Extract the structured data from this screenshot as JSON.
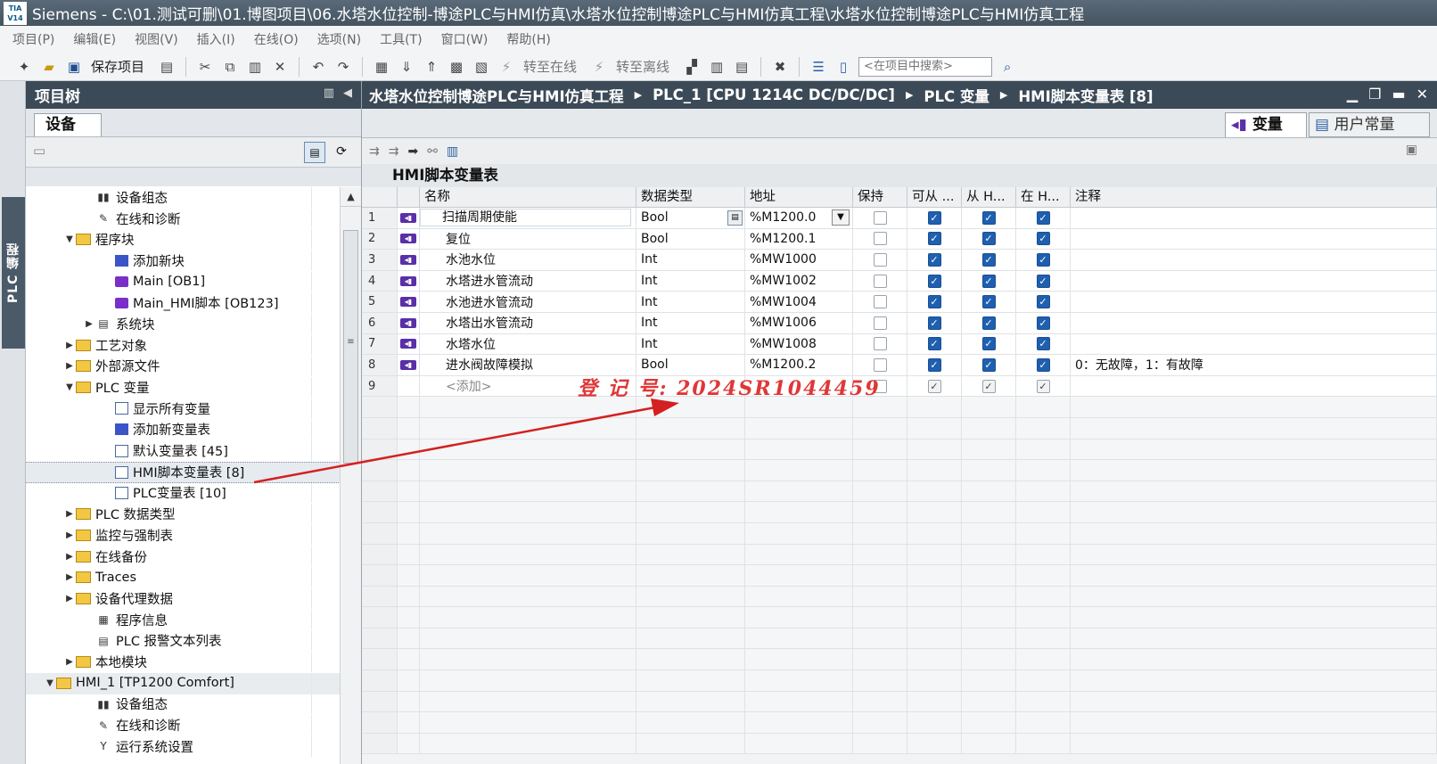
{
  "titlebar": {
    "logo": "TIA V14",
    "title": "Siemens  -  C:\\01.测试可删\\01.博图项目\\06.水塔水位控制-博途PLC与HMI仿真\\水塔水位控制博途PLC与HMI仿真工程\\水塔水位控制博途PLC与HMI仿真工程"
  },
  "menu": [
    "项目(P)",
    "编辑(E)",
    "视图(V)",
    "插入(I)",
    "在线(O)",
    "选项(N)",
    "工具(T)",
    "窗口(W)",
    "帮助(H)"
  ],
  "toolbar": {
    "save_label": "保存项目",
    "go_online": "转至在线",
    "go_offline": "转至离线",
    "search_placeholder": "<在项目中搜索>"
  },
  "left_vtab": "PLC 编程",
  "tree": {
    "header": "项目树",
    "tab": "设备",
    "items": [
      {
        "indent": 3,
        "arrow": "",
        "icon": "gen",
        "glyph": "▮▮",
        "label": "设备组态"
      },
      {
        "indent": 3,
        "arrow": "",
        "icon": "gen",
        "glyph": "✎",
        "label": "在线和诊断"
      },
      {
        "indent": 2,
        "arrow": "▼",
        "icon": "folder",
        "glyph": "",
        "label": "程序块"
      },
      {
        "indent": 4,
        "arrow": "",
        "icon": "add",
        "glyph": "",
        "label": "添加新块"
      },
      {
        "indent": 4,
        "arrow": "",
        "icon": "block",
        "glyph": "",
        "label": "Main [OB1]"
      },
      {
        "indent": 4,
        "arrow": "",
        "icon": "block",
        "glyph": "",
        "label": "Main_HMI脚本 [OB123]"
      },
      {
        "indent": 3,
        "arrow": "▶",
        "icon": "gen",
        "glyph": "▤",
        "label": "系统块"
      },
      {
        "indent": 2,
        "arrow": "▶",
        "icon": "folder",
        "glyph": "",
        "label": "工艺对象"
      },
      {
        "indent": 2,
        "arrow": "▶",
        "icon": "folder",
        "glyph": "",
        "label": "外部源文件"
      },
      {
        "indent": 2,
        "arrow": "▼",
        "icon": "folder",
        "glyph": "",
        "label": "PLC 变量"
      },
      {
        "indent": 4,
        "arrow": "",
        "icon": "table",
        "glyph": "",
        "label": "显示所有变量"
      },
      {
        "indent": 4,
        "arrow": "",
        "icon": "add",
        "glyph": "",
        "label": "添加新变量表"
      },
      {
        "indent": 4,
        "arrow": "",
        "icon": "table",
        "glyph": "",
        "label": "默认变量表 [45]"
      },
      {
        "indent": 4,
        "arrow": "",
        "icon": "table",
        "glyph": "",
        "label": "HMI脚本变量表 [8]",
        "selected": true
      },
      {
        "indent": 4,
        "arrow": "",
        "icon": "table",
        "glyph": "",
        "label": "PLC变量表 [10]"
      },
      {
        "indent": 2,
        "arrow": "▶",
        "icon": "folder",
        "glyph": "",
        "label": "PLC 数据类型"
      },
      {
        "indent": 2,
        "arrow": "▶",
        "icon": "folder",
        "glyph": "",
        "label": "监控与强制表"
      },
      {
        "indent": 2,
        "arrow": "▶",
        "icon": "folder",
        "glyph": "",
        "label": "在线备份"
      },
      {
        "indent": 2,
        "arrow": "▶",
        "icon": "folder",
        "glyph": "",
        "label": "Traces"
      },
      {
        "indent": 2,
        "arrow": "▶",
        "icon": "folder",
        "glyph": "",
        "label": "设备代理数据"
      },
      {
        "indent": 3,
        "arrow": "",
        "icon": "gen",
        "glyph": "▦",
        "label": "程序信息"
      },
      {
        "indent": 3,
        "arrow": "",
        "icon": "gen",
        "glyph": "▤",
        "label": "PLC 报警文本列表"
      },
      {
        "indent": 2,
        "arrow": "▶",
        "icon": "folder",
        "glyph": "",
        "label": "本地模块"
      },
      {
        "indent": 1,
        "arrow": "▼",
        "icon": "folder",
        "glyph": "",
        "label": "HMI_1 [TP1200 Comfort]",
        "hmi": true
      },
      {
        "indent": 3,
        "arrow": "",
        "icon": "gen",
        "glyph": "▮▮",
        "label": "设备组态"
      },
      {
        "indent": 3,
        "arrow": "",
        "icon": "gen",
        "glyph": "✎",
        "label": "在线和诊断"
      },
      {
        "indent": 3,
        "arrow": "",
        "icon": "gen",
        "glyph": "Y",
        "label": "运行系统设置"
      }
    ]
  },
  "editor": {
    "breadcrumb": [
      "水塔水位控制博途PLC与HMI仿真工程",
      "PLC_1 [CPU 1214C DC/DC/DC]",
      "PLC 变量",
      "HMI脚本变量表 [8]"
    ],
    "tab_active": "变量",
    "tab_inactive": "用户常量",
    "table_title": "HMI脚本变量表",
    "columns": [
      "",
      "",
      "名称",
      "数据类型",
      "地址",
      "保持",
      "可从 ...",
      "从 H...",
      "在 H...",
      "注释"
    ],
    "rows": [
      {
        "n": "1",
        "name": "扫描周期使能",
        "type": "Bool",
        "addr": "%M1200.0",
        "retain": false,
        "c1": true,
        "c2": true,
        "c3": true,
        "comment": "",
        "editing": true
      },
      {
        "n": "2",
        "name": "复位",
        "type": "Bool",
        "addr": "%M1200.1",
        "retain": false,
        "c1": true,
        "c2": true,
        "c3": true,
        "comment": ""
      },
      {
        "n": "3",
        "name": "水池水位",
        "type": "Int",
        "addr": "%MW1000",
        "retain": false,
        "c1": true,
        "c2": true,
        "c3": true,
        "comment": ""
      },
      {
        "n": "4",
        "name": "水塔进水管流动",
        "type": "Int",
        "addr": "%MW1002",
        "retain": false,
        "c1": true,
        "c2": true,
        "c3": true,
        "comment": ""
      },
      {
        "n": "5",
        "name": "水池进水管流动",
        "type": "Int",
        "addr": "%MW1004",
        "retain": false,
        "c1": true,
        "c2": true,
        "c3": true,
        "comment": ""
      },
      {
        "n": "6",
        "name": "水塔出水管流动",
        "type": "Int",
        "addr": "%MW1006",
        "retain": false,
        "c1": true,
        "c2": true,
        "c3": true,
        "comment": ""
      },
      {
        "n": "7",
        "name": "水塔水位",
        "type": "Int",
        "addr": "%MW1008",
        "retain": false,
        "c1": true,
        "c2": true,
        "c3": true,
        "comment": ""
      },
      {
        "n": "8",
        "name": "进水阀故障模拟",
        "type": "Bool",
        "addr": "%M1200.2",
        "retain": false,
        "c1": true,
        "c2": true,
        "c3": true,
        "comment": "0：无故障，1：有故障"
      },
      {
        "n": "9",
        "name": "<添加>",
        "type": "",
        "addr": "",
        "retain": false,
        "c1": true,
        "c2": true,
        "c3": true,
        "comment": "",
        "add": true
      }
    ]
  },
  "watermark": "登 记 号:  2024SR1044459",
  "colors": {
    "header_bg": "#3c4a57",
    "checkbox_on": "#1f5fb0",
    "arrow": "#d42020"
  }
}
